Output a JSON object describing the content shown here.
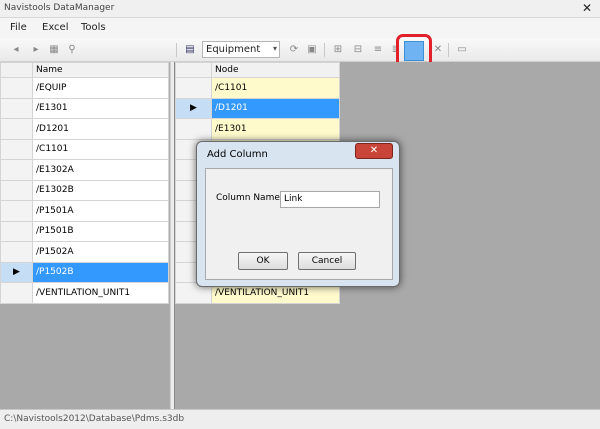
{
  "window": {
    "title": "Navistools DataManager",
    "close_glyph": "✕"
  },
  "menu": [
    "File",
    "Excel",
    "Tools"
  ],
  "toolbar": {
    "dropdown_value": "Equipment",
    "highlight_color": "#e0202a"
  },
  "left_grid": {
    "header": "Name",
    "rows": [
      "/EQUIP",
      "/E1301",
      "/D1201",
      "/C1101",
      "/E1302A",
      "/E1302B",
      "/P1501A",
      "/P1501B",
      "/P1502A",
      "/P1502B",
      "/VENTILATION_UNIT1"
    ],
    "selected_index": 9
  },
  "right_grid": {
    "header": "Node",
    "rows": [
      "/C1101",
      "/D1201",
      "/E1301",
      "",
      "",
      "",
      "",
      "",
      "",
      "",
      "/VENTILATION_UNIT1"
    ],
    "selected_index": 1
  },
  "dialog": {
    "title": "Add Column",
    "close_glyph": "✕",
    "label": "Column Name",
    "value": "Link",
    "ok": "OK",
    "cancel": "Cancel"
  },
  "status": {
    "path": "C:\\Navistools2012\\Database\\Pdms.s3db"
  },
  "row_marker": "▶"
}
